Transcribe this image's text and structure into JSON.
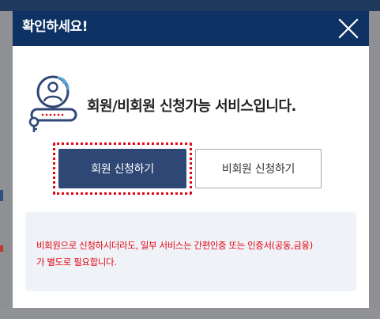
{
  "modal": {
    "title": "확인하세요!",
    "message": "회원/비회원 신청가능 서비스입니다.",
    "member_button": "회원 신청하기",
    "guest_button": "비회원 신청하기",
    "notice_line1": "비회원으로 신청하시더라도, 일부 서비스는 간편인증 또는 인증서(공동,금융)",
    "notice_line2": "가 별도로 필요합니다."
  },
  "colors": {
    "header": "#0d3263",
    "primary_button": "#2f4775",
    "highlight_outline": "#e30613",
    "notice_text": "#e30613",
    "notice_background": "#eff3f8"
  },
  "icons": {
    "close": "close-icon",
    "illustration": "user-login-icon"
  }
}
